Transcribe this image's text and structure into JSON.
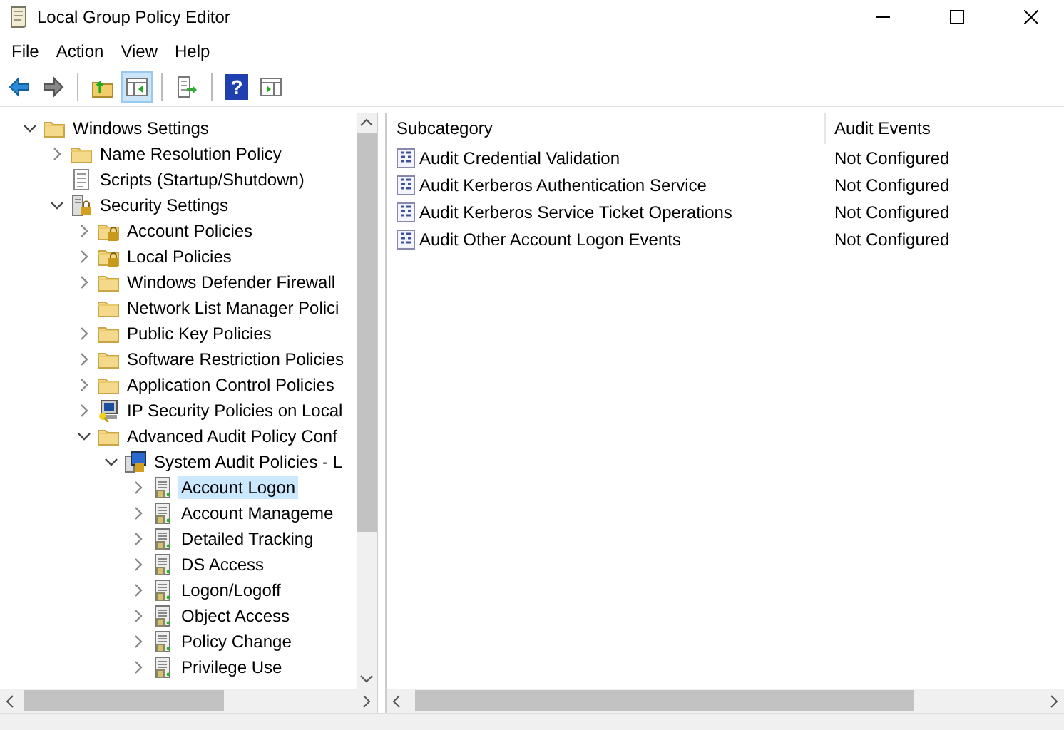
{
  "window": {
    "title": "Local Group Policy Editor"
  },
  "menu": [
    "File",
    "Action",
    "View",
    "Help"
  ],
  "toolbar": [
    {
      "buttons": [
        {
          "kind": "back",
          "selected": false
        },
        {
          "kind": "forward",
          "selected": false
        }
      ]
    },
    {
      "buttons": [
        {
          "kind": "up",
          "selected": false
        },
        {
          "kind": "tree",
          "selected": true
        }
      ]
    },
    {
      "buttons": [
        {
          "kind": "export",
          "selected": false
        }
      ]
    },
    {
      "buttons": [
        {
          "kind": "help",
          "selected": false,
          "glyph": "?"
        },
        {
          "kind": "action-pane",
          "selected": false
        }
      ]
    }
  ],
  "tree": [
    {
      "label": "Windows Settings",
      "kind": "folder",
      "has_children": true,
      "expanded": true,
      "selected": false,
      "children": [
        {
          "label": "Name Resolution Policy",
          "kind": "folder",
          "has_children": true,
          "expanded": false,
          "selected": false
        },
        {
          "label": "Scripts (Startup/Shutdown)",
          "kind": "script",
          "has_children": false,
          "selected": false
        },
        {
          "label": "Security Settings",
          "kind": "security",
          "has_children": true,
          "expanded": true,
          "selected": false,
          "children": [
            {
              "label": "Account Policies",
              "kind": "locked-folder",
              "has_children": true,
              "expanded": false,
              "selected": false
            },
            {
              "label": "Local Policies",
              "kind": "locked-folder",
              "has_children": true,
              "expanded": false,
              "selected": false
            },
            {
              "label": "Windows Defender Firewall",
              "kind": "folder",
              "has_children": true,
              "expanded": false,
              "selected": false
            },
            {
              "label": "Network List Manager Polici",
              "kind": "folder",
              "has_children": false,
              "selected": false
            },
            {
              "label": "Public Key Policies",
              "kind": "folder",
              "has_children": true,
              "expanded": false,
              "selected": false
            },
            {
              "label": "Software Restriction Policies",
              "kind": "folder",
              "has_children": true,
              "expanded": false,
              "selected": false
            },
            {
              "label": "Application Control Policies",
              "kind": "folder",
              "has_children": true,
              "expanded": false,
              "selected": false
            },
            {
              "label": "IP Security Policies on Local",
              "kind": "ipsec",
              "has_children": true,
              "expanded": false,
              "selected": false
            },
            {
              "label": "Advanced Audit Policy Conf",
              "kind": "folder",
              "has_children": true,
              "expanded": true,
              "selected": false,
              "children": [
                {
                  "label": "System Audit Policies - L",
                  "kind": "audit-root",
                  "has_children": true,
                  "expanded": true,
                  "selected": false,
                  "children": [
                    {
                      "label": "Account Logon",
                      "kind": "audit",
                      "has_children": true,
                      "expanded": false,
                      "selected": true
                    },
                    {
                      "label": "Account Manageme",
                      "kind": "audit",
                      "has_children": true,
                      "expanded": false,
                      "selected": false
                    },
                    {
                      "label": "Detailed Tracking",
                      "kind": "audit",
                      "has_children": true,
                      "expanded": false,
                      "selected": false
                    },
                    {
                      "label": "DS Access",
                      "kind": "audit",
                      "has_children": true,
                      "expanded": false,
                      "selected": false
                    },
                    {
                      "label": "Logon/Logoff",
                      "kind": "audit",
                      "has_children": true,
                      "expanded": false,
                      "selected": false
                    },
                    {
                      "label": "Object Access",
                      "kind": "audit",
                      "has_children": true,
                      "expanded": false,
                      "selected": false
                    },
                    {
                      "label": "Policy Change",
                      "kind": "audit",
                      "has_children": true,
                      "expanded": false,
                      "selected": false
                    },
                    {
                      "label": "Privilege Use",
                      "kind": "audit",
                      "has_children": true,
                      "expanded": false,
                      "selected": false
                    }
                  ]
                }
              ]
            }
          ]
        }
      ]
    }
  ],
  "table": {
    "columns": [
      "Subcategory",
      "Audit Events"
    ],
    "rows": [
      {
        "subcategory": "Audit Credential Validation",
        "audit_events": "Not Configured"
      },
      {
        "subcategory": "Audit Kerberos Authentication Service",
        "audit_events": "Not Configured"
      },
      {
        "subcategory": "Audit Kerberos Service Ticket Operations",
        "audit_events": "Not Configured"
      },
      {
        "subcategory": "Audit Other Account Logon Events",
        "audit_events": "Not Configured"
      }
    ]
  }
}
